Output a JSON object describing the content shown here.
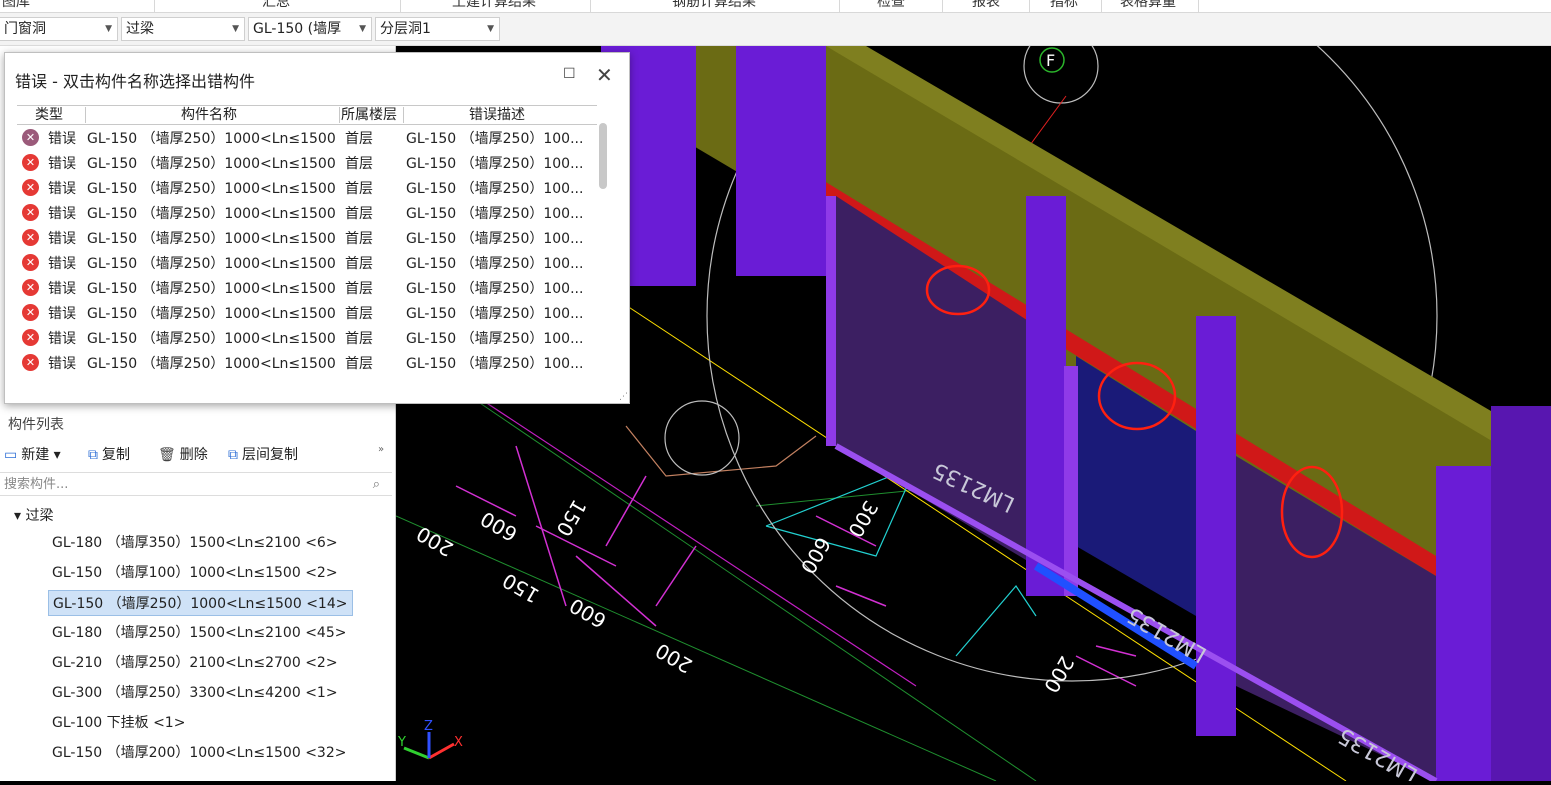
{
  "tabs": [
    "图库",
    "汇总",
    "土建计算结果",
    "钢筋计算结果",
    "检查",
    "报表",
    "指标",
    "表格算量"
  ],
  "toolbar": {
    "selects": [
      "门窗洞",
      "过梁",
      "GL-150 (墙厚",
      "分层洞1"
    ]
  },
  "error_dialog": {
    "title": "错误 - 双击构件名称选择出错构件",
    "columns": [
      "类型",
      "构件名称",
      "所属楼层",
      "错误描述"
    ],
    "rows": [
      {
        "type": "错误",
        "name": "GL-150 （墙厚250）1000<Ln≤1500",
        "floor": "首层",
        "desc": "GL-150 （墙厚250）100..."
      },
      {
        "type": "错误",
        "name": "GL-150 （墙厚250）1000<Ln≤1500",
        "floor": "首层",
        "desc": "GL-150 （墙厚250）100..."
      },
      {
        "type": "错误",
        "name": "GL-150 （墙厚250）1000<Ln≤1500",
        "floor": "首层",
        "desc": "GL-150 （墙厚250）100..."
      },
      {
        "type": "错误",
        "name": "GL-150 （墙厚250）1000<Ln≤1500",
        "floor": "首层",
        "desc": "GL-150 （墙厚250）100..."
      },
      {
        "type": "错误",
        "name": "GL-150 （墙厚250）1000<Ln≤1500",
        "floor": "首层",
        "desc": "GL-150 （墙厚250）100..."
      },
      {
        "type": "错误",
        "name": "GL-150 （墙厚250）1000<Ln≤1500",
        "floor": "首层",
        "desc": "GL-150 （墙厚250）100..."
      },
      {
        "type": "错误",
        "name": "GL-150 （墙厚250）1000<Ln≤1500",
        "floor": "首层",
        "desc": "GL-150 （墙厚250）100..."
      },
      {
        "type": "错误",
        "name": "GL-150 （墙厚250）1000<Ln≤1500",
        "floor": "首层",
        "desc": "GL-150 （墙厚250）100..."
      },
      {
        "type": "错误",
        "name": "GL-150 （墙厚250）1000<Ln≤1500",
        "floor": "首层",
        "desc": "GL-150 （墙厚250）100..."
      },
      {
        "type": "错误",
        "name": "GL-150 （墙厚250）1000<Ln≤1500",
        "floor": "首层",
        "desc": "GL-150 （墙厚250）100..."
      }
    ]
  },
  "component_list": {
    "title": "构件列表",
    "tools": [
      "新建",
      "复制",
      "删除",
      "层间复制"
    ],
    "search_placeholder": "搜索构件...",
    "root": "过梁",
    "items": [
      "GL-180 （墙厚350）1500<Ln≤2100 <6>",
      "GL-150 （墙厚100）1000<Ln≤1500 <2>",
      "GL-150 （墙厚250）1000<Ln≤1500 <14>",
      "GL-180 （墙厚250）1500<Ln≤2100 <45>",
      "GL-210 （墙厚250）2100<Ln≤2700 <2>",
      "GL-300 （墙厚250）3300<Ln≤4200 <1>",
      "GL-100 下挂板 <1>",
      "GL-150 （墙厚200）1000<Ln≤1500 <32>"
    ],
    "selected_index": 2
  },
  "viewport": {
    "axis_label": "F",
    "dims": [
      "200",
      "600",
      "150",
      "150",
      "600",
      "200",
      "300",
      "600",
      "200"
    ],
    "window_labels": [
      "LM2135",
      "LM2135",
      "LM2135"
    ],
    "axes": [
      "X",
      "Y",
      "Z"
    ]
  }
}
